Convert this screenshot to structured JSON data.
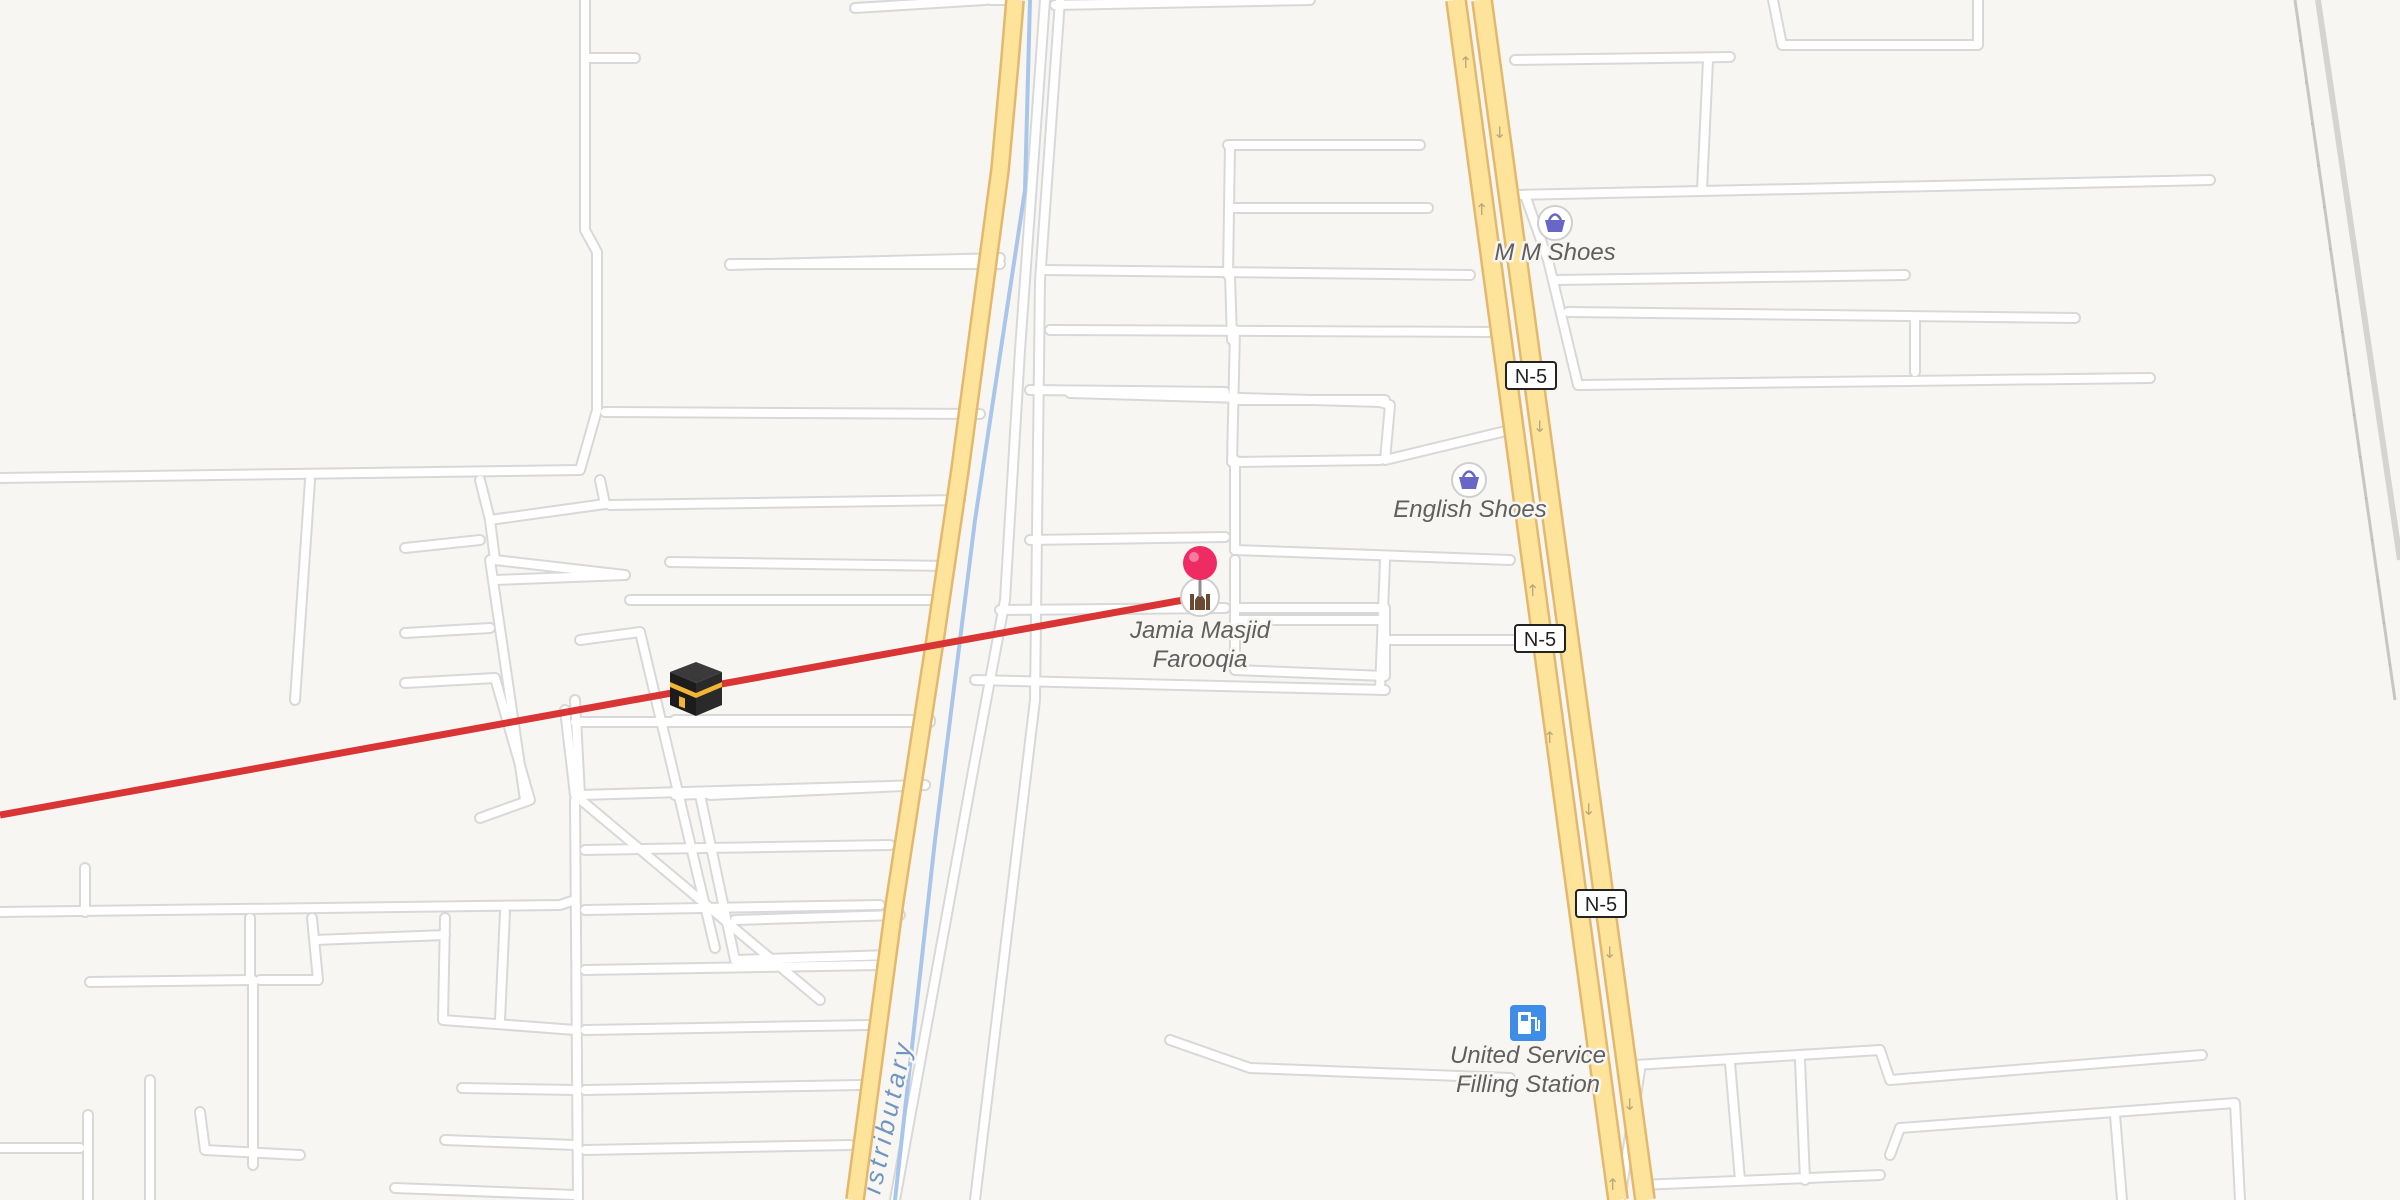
{
  "map": {
    "background": "#f8f6f3",
    "highway": {
      "ref": "N-5",
      "fill_color": "#fde49a",
      "casing_color": "#e4b86c"
    },
    "canal": {
      "label": "istributary",
      "color": "#a9c6ea"
    },
    "route_line": {
      "color": "#d93535",
      "description": "Qibla direction line"
    },
    "pois": [
      {
        "name": "M M Shoes",
        "icon": "shopping-basket-icon",
        "color": "#6867c8"
      },
      {
        "name": "English Shoes",
        "icon": "shopping-basket-icon",
        "color": "#6867c8"
      },
      {
        "name_line1": "Jamia Masjid",
        "name_line2": "Farooqia",
        "icon": "mosque-icon",
        "pin_color": "#ee2b63"
      },
      {
        "name_line1": "United Service",
        "name_line2": "Filling Station",
        "icon": "fuel-pump-icon",
        "color": "#3e8ee7"
      }
    ],
    "kaaba_marker": {
      "icon": "kaaba-icon"
    }
  }
}
